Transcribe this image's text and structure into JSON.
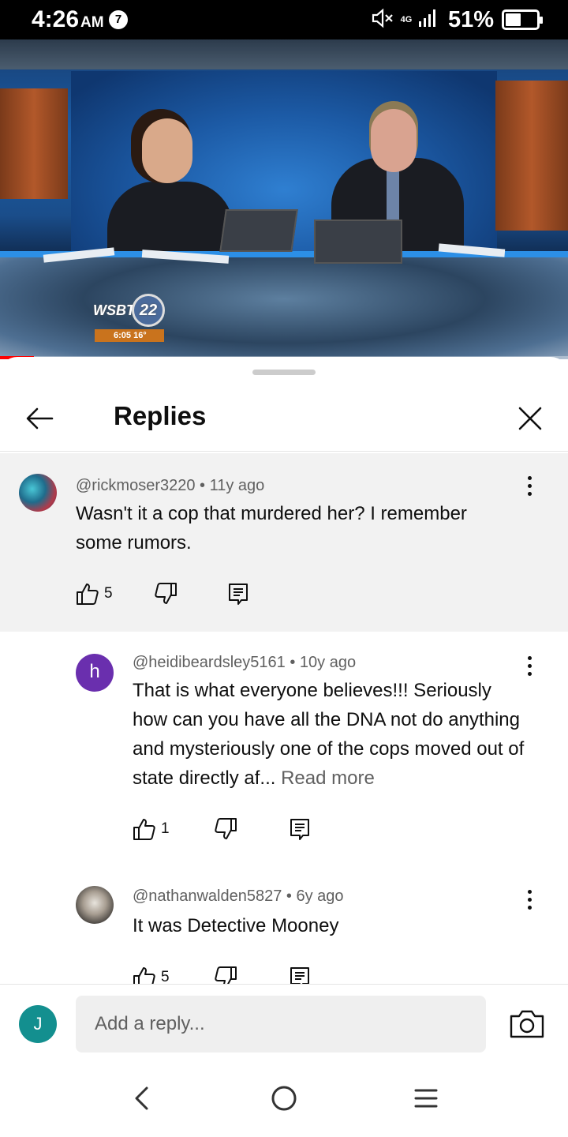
{
  "status_bar": {
    "time": "4:26",
    "ampm": "AM",
    "notification_count": "7",
    "network": "4G",
    "battery_percent": "51%",
    "battery_level": 0.51
  },
  "video": {
    "channel_logo": "WSBT",
    "channel_number": "22",
    "timestamp_overlay": "6:05 16°",
    "played_fraction": 0.06
  },
  "sheet": {
    "title": "Replies"
  },
  "comments": [
    {
      "handle": "@rickmoser3220",
      "age": "11y ago",
      "text": "Wasn't it a cop that murdered her? I remember some rumors.",
      "likes": "5"
    },
    {
      "handle": "@heidibeardsley5161",
      "age": "10y ago",
      "avatar_letter": "h",
      "text": "That is what everyone believes!!! Seriously how can you have all the DNA not do anything and mysteriously one of the cops moved out of state directly af...",
      "read_more": "Read more",
      "likes": "1"
    },
    {
      "handle": "@nathanwalden5827",
      "age": "6y ago",
      "text": "It was Detective Mooney",
      "likes": "5"
    }
  ],
  "meta_separator": "•",
  "reply_bar": {
    "avatar_letter": "J",
    "placeholder": "Add a reply..."
  },
  "icons": {
    "back": "arrow-left-icon",
    "close": "close-icon",
    "more": "more-vert-icon",
    "like": "thumb-up-icon",
    "dislike": "thumb-down-icon",
    "reply": "comment-icon",
    "camera": "camera-icon"
  }
}
